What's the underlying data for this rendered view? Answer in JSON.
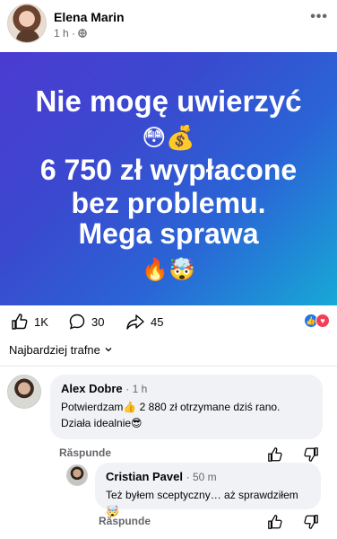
{
  "post": {
    "author": "Elena Marin",
    "time": "1 h",
    "privacy_icon": "globe-icon",
    "more_icon": "more-horizontal-icon",
    "banner": {
      "line1": "Nie mogę uwierzyć",
      "emoji1": "😳💰",
      "line2": "6 750 zł wypłacone",
      "line3": "bez problemu.",
      "line4": "Mega sprawa",
      "emoji2": "🔥🤯",
      "colors": [
        "#4b3bd1",
        "#2a64d6",
        "#17a9d6"
      ]
    }
  },
  "actions": {
    "likes": "1K",
    "comments": "30",
    "shares": "45"
  },
  "sort": {
    "label": "Najbardziej trafne"
  },
  "comments": [
    {
      "author": "Alex Dobre",
      "time": "1 h",
      "text_line1": "Potwierdzam👍 2 880 zł otrzymane dziś rano.",
      "text_line2": "Działa idealnie😎",
      "reply": "Răspunde"
    },
    {
      "author": "Cristian Pavel",
      "time": "50 m",
      "text": "Też byłem sceptyczny… aż sprawdziłem🤯",
      "reply": "Răspunde"
    }
  ]
}
